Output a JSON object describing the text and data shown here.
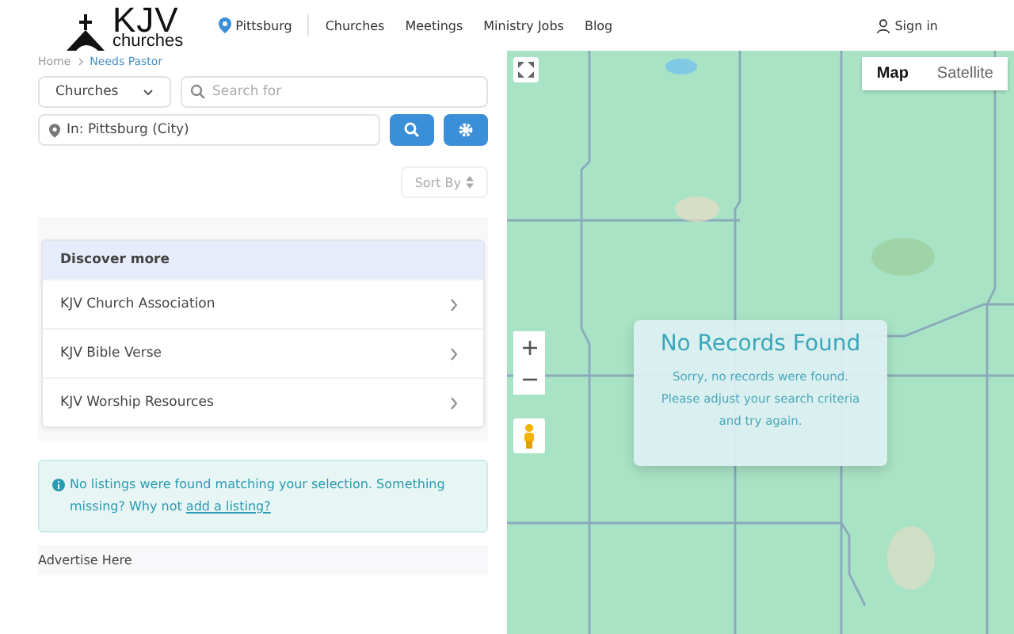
{
  "header": {
    "logo": {
      "main": "KJV",
      "sub": "churches"
    },
    "location": "Pittsburg",
    "nav": [
      "Churches",
      "Meetings",
      "Ministry Jobs",
      "Blog"
    ],
    "sign_in": "Sign in"
  },
  "breadcrumb": [
    "Home",
    "Needs Pastor"
  ],
  "search": {
    "category": "Churches",
    "placeholder": "Search for",
    "location": "In: Pittsburg (City)"
  },
  "sort": "Sort By",
  "discover": {
    "title": "Discover more",
    "items": [
      "KJV Church Association",
      "KJV Bible Verse",
      "KJV Worship Resources"
    ]
  },
  "notice": {
    "text": "No listings were found matching your selection. Something missing? Why not",
    "link": "add a listing?"
  },
  "advertise": "Advertise Here",
  "map": {
    "types": [
      {
        "label": "Map",
        "selected": true
      },
      {
        "label": "Satellite",
        "selected": false
      }
    ],
    "overlay": {
      "title": "No Records Found",
      "lines": [
        "Sorry, no records were found.",
        "Please adjust your search criteria",
        "and try again."
      ]
    }
  }
}
